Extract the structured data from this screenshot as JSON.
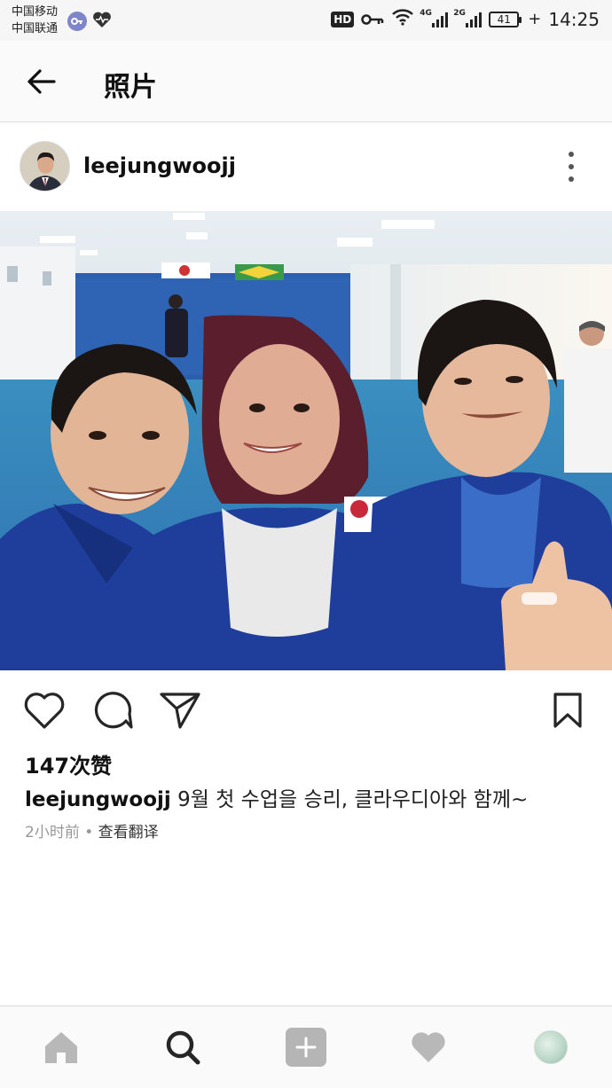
{
  "status_bar": {
    "carrier_1": "中国移动",
    "carrier_2": "中国联通",
    "hd_label": "HD",
    "net_1": "4G",
    "net_2": "2G",
    "battery": "41",
    "time": "14:25"
  },
  "app_bar": {
    "title": "照片",
    "back_icon": "arrow-left-icon"
  },
  "post": {
    "username": "leejungwoojj",
    "more_icon": "more-vertical-icon",
    "image_description_icon": "photo-image",
    "likes": "147次赞",
    "caption_user": "leejungwoojj",
    "caption_text": " 9월 첫 수업을 승리, 클라우디아와 함께~",
    "time_ago": "2小时前",
    "separator": " • ",
    "translate_link": "查看翻译"
  },
  "actions": {
    "like_icon": "heart-outline-icon",
    "comment_icon": "comment-icon",
    "share_icon": "send-icon",
    "save_icon": "bookmark-icon"
  },
  "bottom_nav": {
    "items": [
      "home-icon",
      "search-icon",
      "add-post-icon",
      "activity-heart-icon",
      "profile-avatar"
    ]
  },
  "colors": {
    "icon_dark": "#262626",
    "nav_inactive": "#b8b8b8",
    "meta_gray": "#999999"
  }
}
